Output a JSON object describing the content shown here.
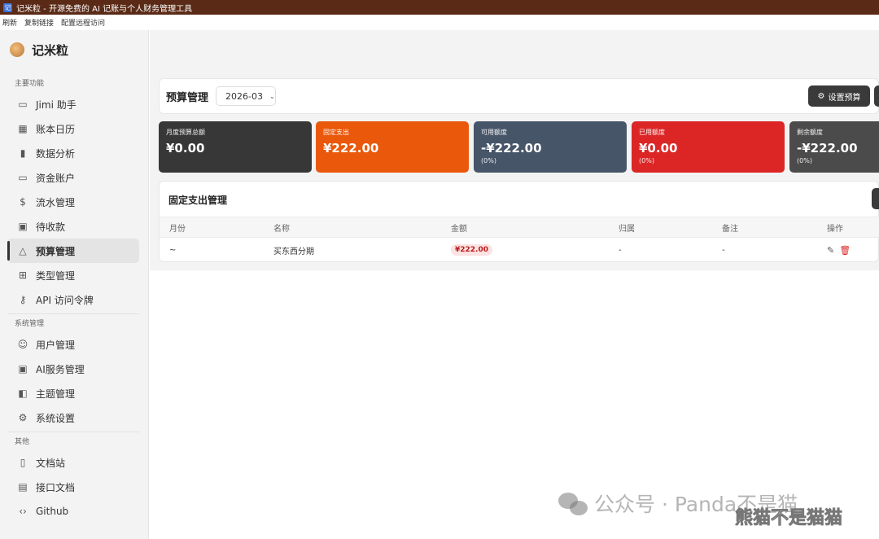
{
  "window": {
    "title": "记米粒 - 开源免费的 AI 记账与个人财务管理工具"
  },
  "menu": [
    "刷新",
    "复制链接",
    "配置远程访问"
  ],
  "brand": {
    "name": "记米粒"
  },
  "sidebar": {
    "section_main": "主要功能",
    "main_items": [
      {
        "label": "Jimi 助手",
        "icon": "chat-icon"
      },
      {
        "label": "账本日历",
        "icon": "calendar-icon"
      },
      {
        "label": "数据分析",
        "icon": "bar-chart-icon"
      },
      {
        "label": "资金账户",
        "icon": "card-icon"
      },
      {
        "label": "流水管理",
        "icon": "dollar-icon"
      },
      {
        "label": "待收款",
        "icon": "receivable-icon"
      },
      {
        "label": "预算管理",
        "icon": "warning-triangle-icon",
        "active": true
      },
      {
        "label": "类型管理",
        "icon": "grid-icon"
      },
      {
        "label": "API 访问令牌",
        "icon": "key-icon"
      }
    ],
    "section_system": "系统管理",
    "system_items": [
      {
        "label": "用户管理",
        "icon": "users-icon"
      },
      {
        "label": "AI服务管理",
        "icon": "chip-icon"
      },
      {
        "label": "主题管理",
        "icon": "palette-icon"
      },
      {
        "label": "系统设置",
        "icon": "gear-icon"
      }
    ],
    "section_other": "其他",
    "other_items": [
      {
        "label": "文档站",
        "icon": "book-icon"
      },
      {
        "label": "接口文档",
        "icon": "file-icon"
      },
      {
        "label": "Github",
        "icon": "code-icon"
      }
    ]
  },
  "header": {
    "title": "预算管理",
    "month": "2026-03",
    "set_budget_label": "设置预算"
  },
  "stats": [
    {
      "label": "月度预算总额",
      "value": "¥0.00",
      "pct": "",
      "color": "#373737"
    },
    {
      "label": "固定支出",
      "value": "¥222.00",
      "pct": "",
      "color": "#ea580c"
    },
    {
      "label": "可用额度",
      "value": "-¥222.00",
      "pct": "(0%)",
      "color": "#475569"
    },
    {
      "label": "已用额度",
      "value": "¥0.00",
      "pct": "(0%)",
      "color": "#dc2626"
    },
    {
      "label": "剩余额度",
      "value": "-¥222.00",
      "pct": "(0%)",
      "color": "#4b4b4b"
    }
  ],
  "fixed": {
    "title": "固定支出管理",
    "columns": [
      "月份",
      "名称",
      "金额",
      "归属",
      "备注",
      "操作"
    ],
    "rows": [
      {
        "month": "~",
        "name": "买东西分期",
        "amount": "¥222.00",
        "owner": "-",
        "note": "-"
      }
    ]
  },
  "watermark": {
    "text": "公众号 · Panda不是猫",
    "text2": "熊猫不是猫猫"
  }
}
